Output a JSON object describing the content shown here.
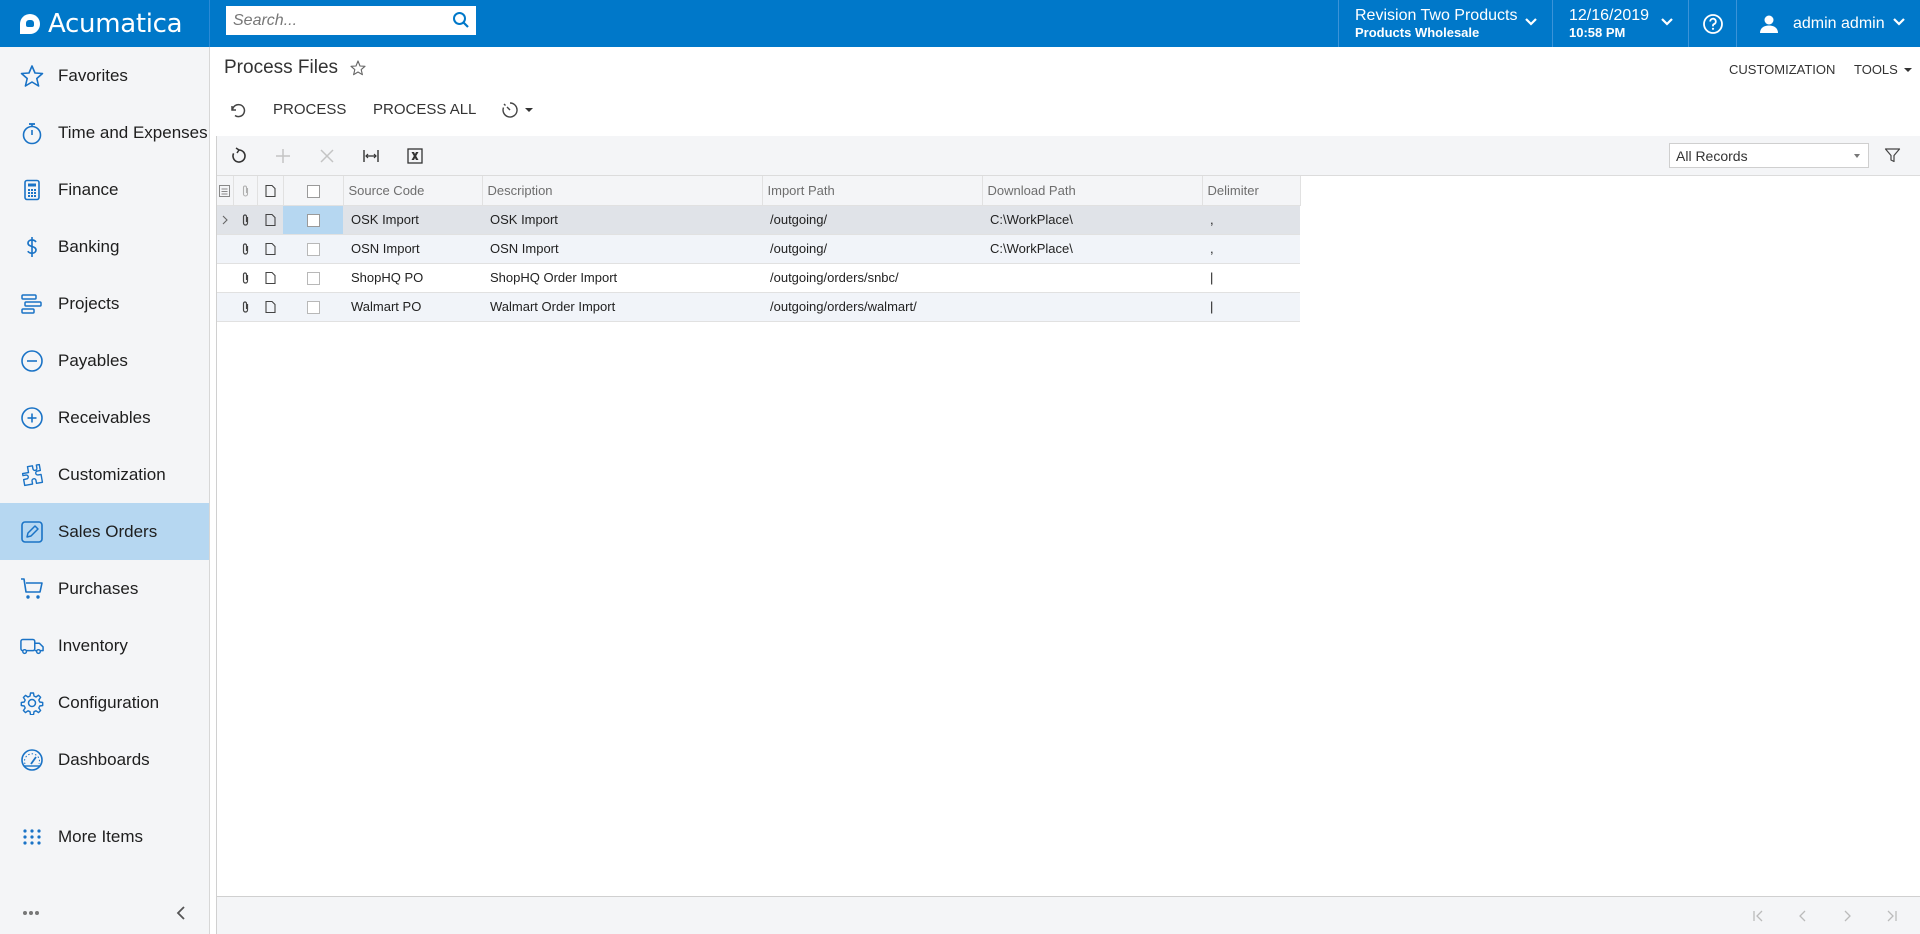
{
  "app": {
    "brand": "Acumatica",
    "search_placeholder": "Search...",
    "company": {
      "name": "Revision Two Products",
      "branch": "Products Wholesale"
    },
    "datetime": {
      "date": "12/16/2019",
      "time": "10:58 PM"
    },
    "user": "admin admin",
    "accent_color": "#0078c9"
  },
  "sidebar": {
    "items": [
      {
        "label": "Favorites",
        "icon": "star-icon"
      },
      {
        "label": "Time and Expenses",
        "icon": "stopwatch-icon"
      },
      {
        "label": "Finance",
        "icon": "calculator-icon"
      },
      {
        "label": "Banking",
        "icon": "dollar-icon"
      },
      {
        "label": "Projects",
        "icon": "projects-icon"
      },
      {
        "label": "Payables",
        "icon": "minus-circle-icon"
      },
      {
        "label": "Receivables",
        "icon": "plus-circle-icon"
      },
      {
        "label": "Customization",
        "icon": "puzzle-icon"
      },
      {
        "label": "Sales Orders",
        "icon": "edit-icon",
        "active": true
      },
      {
        "label": "Purchases",
        "icon": "cart-icon"
      },
      {
        "label": "Inventory",
        "icon": "truck-icon"
      },
      {
        "label": "Configuration",
        "icon": "gear-icon"
      },
      {
        "label": "Dashboards",
        "icon": "gauge-icon"
      }
    ],
    "more_items": "More Items"
  },
  "page": {
    "title": "Process Files",
    "links": {
      "customization": "CUSTOMIZATION",
      "tools": "TOOLS"
    },
    "actions": {
      "process": "PROCESS",
      "process_all": "PROCESS ALL"
    }
  },
  "grid": {
    "filter_selected": "All Records",
    "columns": [
      "Source Code",
      "Description",
      "Import Path",
      "Download Path",
      "Delimiter"
    ],
    "rows": [
      {
        "source_code": "OSK Import",
        "description": "OSK Import",
        "import_path": "/outgoing/",
        "download_path": "C:\\WorkPlace\\",
        "delimiter": ","
      },
      {
        "source_code": "OSN Import",
        "description": "OSN Import",
        "import_path": "/outgoing/",
        "download_path": "C:\\WorkPlace\\",
        "delimiter": ","
      },
      {
        "source_code": "ShopHQ PO",
        "description": "ShopHQ Order Import",
        "import_path": "/outgoing/orders/snbc/",
        "download_path": "",
        "delimiter": "|"
      },
      {
        "source_code": "Walmart PO",
        "description": "Walmart Order Import",
        "import_path": "/outgoing/orders/walmart/",
        "download_path": "",
        "delimiter": "|"
      }
    ]
  }
}
